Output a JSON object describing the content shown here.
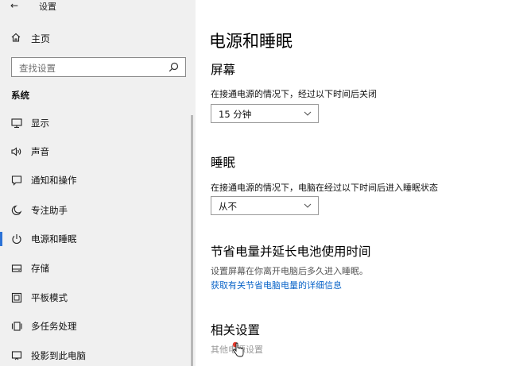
{
  "window": {
    "title": "设置"
  },
  "sidebar": {
    "home_label": "主页",
    "search_placeholder": "查找设置",
    "section_label": "系统",
    "items": [
      {
        "label": "显示",
        "icon": "monitor-icon"
      },
      {
        "label": "声音",
        "icon": "speaker-icon"
      },
      {
        "label": "通知和操作",
        "icon": "notification-icon"
      },
      {
        "label": "专注助手",
        "icon": "moon-icon"
      },
      {
        "label": "电源和睡眠",
        "icon": "power-icon",
        "active": true
      },
      {
        "label": "存储",
        "icon": "storage-icon"
      },
      {
        "label": "平板模式",
        "icon": "tablet-icon"
      },
      {
        "label": "多任务处理",
        "icon": "multitask-icon"
      },
      {
        "label": "投影到此电脑",
        "icon": "projector-icon"
      }
    ]
  },
  "main": {
    "page_title": "电源和睡眠",
    "screen": {
      "heading": "屏幕",
      "desc": "在接通电源的情况下，经过以下时间后关闭",
      "value": "15 分钟"
    },
    "sleep": {
      "heading": "睡眠",
      "desc": "在接通电源的情况下，电脑在经过以下时间后进入睡眠状态",
      "value": "从不"
    },
    "battery": {
      "heading": "节省电量并延长电池使用时间",
      "desc": "设置屏幕在你离开电脑后多久进入睡眠。",
      "link": "获取有关节省电脑电量的详细信息"
    },
    "related": {
      "heading": "相关设置",
      "partial_link": "其他电源设置"
    }
  },
  "colors": {
    "accent": "#2b72d6",
    "link": "#0a64c8",
    "sidebar_bg": "#f0f0f0"
  }
}
